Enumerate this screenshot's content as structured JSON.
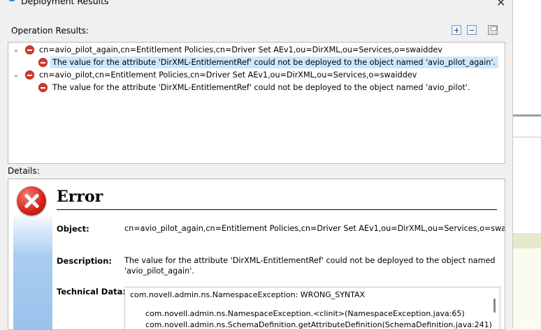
{
  "window": {
    "title": "Deployment Results",
    "close_glyph": "✕",
    "title_icon": "app-icon"
  },
  "operation_results": {
    "label": "Operation Results:",
    "toolbar": {
      "expand_icon": "expand-all-icon",
      "collapse_icon": "collapse-all-icon",
      "save_icon": "save-icon"
    },
    "items": [
      {
        "dn": "cn=avio_pilot_again,cn=Entitlement Policies,cn=Driver Set AEv1,ou=DirXML,ou=Services,o=swaiddev",
        "message": "The value for the attribute 'DirXML-EntitlementRef' could not be deployed to the object named 'avio_pilot_again'."
      },
      {
        "dn": "cn=avio_pilot,cn=Entitlement Policies,cn=Driver Set AEv1,ou=DirXML,ou=Services,o=swaiddev",
        "message": "The value for the attribute 'DirXML-EntitlementRef' could not be deployed to the object named 'avio_pilot'."
      }
    ]
  },
  "details": {
    "label": "Details:",
    "heading": "Error",
    "object_label": "Object:",
    "object_value": "cn=avio_pilot_again,cn=Entitlement Policies,cn=Driver Set AEv1,ou=DirXML,ou=Services,o=swaiddev",
    "description_label": "Description:",
    "description_line1": "The value for the attribute 'DirXML-EntitlementRef' could not be deployed to the object named",
    "description_line2": "'avio_pilot_again'.",
    "technical_label": "Technical Data:",
    "technical_lines": [
      "com.novell.admin.ns.NamespaceException: WRONG_SYNTAX",
      "com.novell.admin.ns.NamespaceException.<clinit>(NamespaceException.java:65)",
      "com.novell.admin.ns.SchemaDefinition.getAttributeDefinition(SchemaDefinition.java:241)"
    ]
  }
}
